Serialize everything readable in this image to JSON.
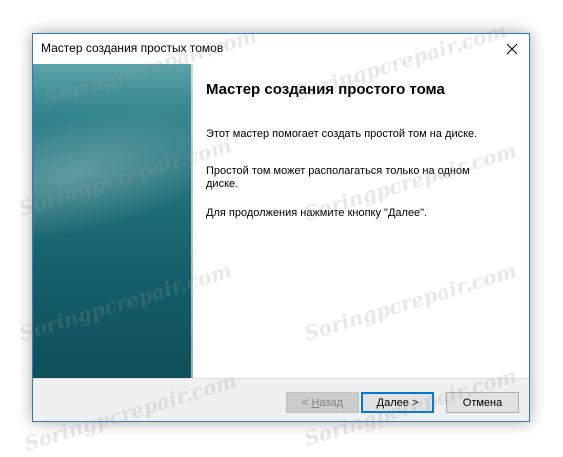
{
  "window": {
    "title": "Мастер создания простых томов",
    "close_icon": "close-icon"
  },
  "wizard": {
    "heading": "Мастер создания простого тома",
    "paragraphs": [
      "Этот мастер помогает создать простой том на диске.",
      "Простой том может располагаться только на одном диске.",
      "Для продолжения нажмите кнопку \"Далее\"."
    ]
  },
  "buttons": {
    "back": {
      "prefix": "< ",
      "mnemonic": "Н",
      "rest": "азад",
      "enabled": false
    },
    "next": {
      "mnemonic": "Д",
      "rest": "алее >",
      "default": true
    },
    "cancel": {
      "label": "Отмена"
    }
  },
  "watermark": {
    "text": "Soringpcrepair.com"
  },
  "colors": {
    "accent_border": "#2b7bc4",
    "banner_top": "#5aa3a9",
    "banner_bottom": "#0f4f5a",
    "footer_bg": "#f0f0f0",
    "default_button_border": "#0078d7"
  }
}
